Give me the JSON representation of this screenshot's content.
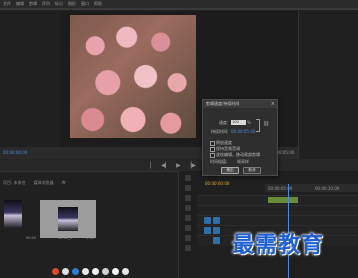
{
  "menu": [
    "文件",
    "编辑",
    "剪辑",
    "序列",
    "标记",
    "图形",
    "窗口",
    "帮助"
  ],
  "monitor": {
    "timecode_left": "00:00:00:00",
    "timecode_right": "00:00:05:00"
  },
  "project": {
    "tabs": [
      "项目: 未命名",
      "媒体浏览器",
      "库"
    ],
    "items": [
      {
        "label": "00:00",
        "thumb": "thumb1"
      },
      {
        "label": "00:00_1",
        "thumb": "thumb2"
      },
      {
        "label": "5:00",
        "thumb": "thumb2"
      }
    ]
  },
  "dialog": {
    "title": "剪辑速度/持续时间",
    "speed_label": "速度:",
    "speed_value": "100",
    "speed_unit": "%",
    "duration_label": "持续时间:",
    "duration_value": "00:00:05:00",
    "option_reverse": "倒放速度",
    "option_pitch": "保持音频音调",
    "option_ripple": "波纹编辑，移动尾部剪辑",
    "interp_label": "时间插值:",
    "interp_value": "帧采样",
    "ok_label": "确定",
    "cancel_label": "取消"
  },
  "sequence": {
    "timecode": "00:00:00:00",
    "ruler_label": "00:00:05:00",
    "ruler_label2": "00:00:10:00"
  },
  "watermark": "最需教育"
}
